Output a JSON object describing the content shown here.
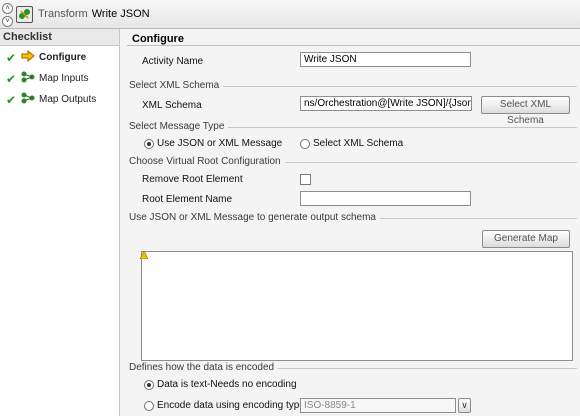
{
  "header": {
    "collapse_up": "˄",
    "collapse_down": "˅",
    "title_prefix": "Transform",
    "title": "Write JSON"
  },
  "checklist": {
    "title": "Checklist",
    "items": [
      {
        "label": "Configure",
        "icon": "arrow-right-icon",
        "done": true,
        "active": true
      },
      {
        "label": "Map Inputs",
        "icon": "map-icon",
        "done": true,
        "active": false
      },
      {
        "label": "Map Outputs",
        "icon": "map-icon",
        "done": true,
        "active": false
      }
    ]
  },
  "configure": {
    "title": "Configure",
    "activity_name_label": "Activity Name",
    "activity_name_value": "Write JSON",
    "schema_section": "Select XML Schema",
    "xml_schema_label": "XML Schema",
    "xml_schema_value": "ns/Orchestration@[Write JSON]/{JsonXml}",
    "select_schema_button": "Select XML Schema",
    "message_section": "Select Message Type",
    "radio_json": "Use JSON or XML Message",
    "radio_schema": "Select XML Schema",
    "root_section": "Choose Virtual Root Configuration",
    "remove_root_label": "Remove Root Element",
    "root_name_label": "Root Element Name",
    "root_name_value": "",
    "output_section": "Use JSON or XML Message to generate output schema",
    "generate_button": "Generate Map",
    "message_text": "",
    "encoding_section": "Defines how the data is encoded",
    "radio_no_encoding": "Data is text-Needs no encoding",
    "radio_encode": "Encode data using encoding type:",
    "encoding_value": "ISO-8859-1",
    "encoding_dropdown": "∨"
  },
  "colors": {
    "accent_check": "#1e9a1e",
    "arrow": "#e0a000"
  }
}
